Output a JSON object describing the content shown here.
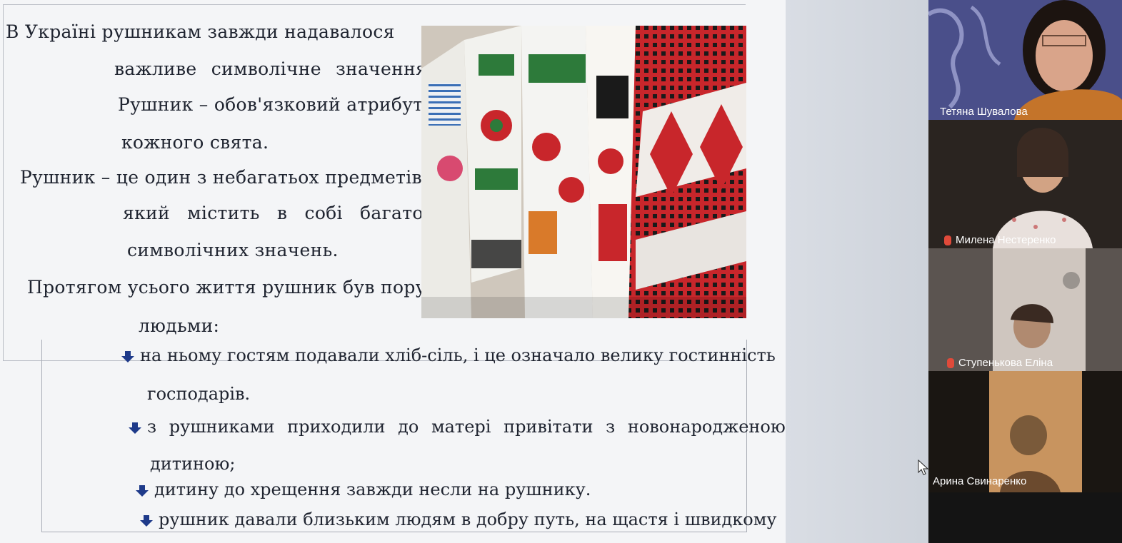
{
  "slide": {
    "intro_lines": [
      "В Україні рушникам завжди надавалося",
      "важливе символічне значення.",
      "Рушник – обов'язковий атрибут",
      "кожного свята.",
      "Рушник – це один з небагатьох предметів,",
      "який містить в собі багато",
      "символічних значень.",
      "Протягом усього життя рушник був поруч з",
      "людьми:"
    ],
    "bullets": [
      "на ньому гостям подавали хліб-сіль, і це означало велику гостинність",
      "господарів.",
      "з рушниками приходили до матері привітати з новонародженою",
      "дитиною;",
      "дитину до хрещення завжди несли на рушнику.",
      "рушник давали близьким людям в добру путь, на щастя і швидкому"
    ],
    "image_subject": "embroidered-towels"
  },
  "participants": [
    {
      "name": "Тетяна Шувалова",
      "muted": false
    },
    {
      "name": "Милена Нестеренко",
      "muted": true
    },
    {
      "name": "Ступенькова Еліна",
      "muted": true
    },
    {
      "name": "Арина Свинаренко",
      "muted": false
    }
  ],
  "colors": {
    "embroidery_red": "#c8262b",
    "embroidery_black": "#1a1a1a",
    "mic_muted": "#e04a3a",
    "bullet_arrow": "#1e3a8a"
  }
}
